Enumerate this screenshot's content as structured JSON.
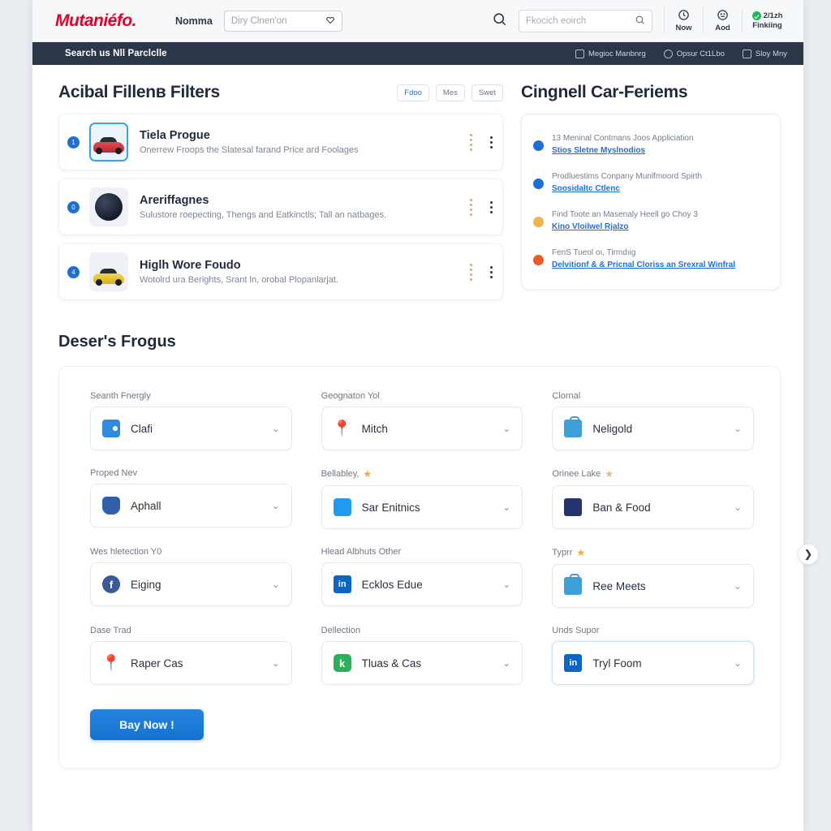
{
  "header": {
    "logo": "Mutaniéfo.",
    "brand_label": "Nomma",
    "location_placeholder": "Diry Clnen'on",
    "location_icon": "heart-icon",
    "search_placeholder": "Fkocich  eoirch",
    "actions": [
      {
        "label": "Now",
        "icon": "clock-icon"
      },
      {
        "label": "Aod",
        "icon": "smiley-icon"
      }
    ],
    "status": {
      "count": "2/1zh",
      "label": "Finkiing"
    }
  },
  "subnav": {
    "title": "Search us Nll Parclclle",
    "links": [
      {
        "label": "Megioc Manbnrg",
        "icon": "lock-icon"
      },
      {
        "label": "Opsur Ct1Lbo",
        "icon": "contact-icon"
      },
      {
        "label": "Sloy Mny",
        "icon": "camera-icon"
      }
    ]
  },
  "filters_section": {
    "title": "Acibal Fillenв Filters",
    "chips": [
      {
        "label": "Fdoo",
        "active": true
      },
      {
        "label": "Mes",
        "active": false
      },
      {
        "label": "Swet",
        "active": false
      }
    ],
    "items": [
      {
        "badge": "1",
        "title": "Tiela Progue",
        "subtitle": "Onerrew Froops the Slatesal farand Price ard Foolages",
        "thumb": "red-car-icon",
        "selected": true
      },
      {
        "badge": "0",
        "title": "Areriffagnes",
        "subtitle": "Sulustore roepecting, Thengs and Eatkinctls; Tall an natbages.",
        "thumb": "dark-orb-icon",
        "selected": false
      },
      {
        "badge": "4",
        "title": "Higlh Wore Foudo",
        "subtitle": "Wotolrd ura Berights, Srant ln, orobal Plopanlarjat.",
        "thumb": "yellow-car-icon",
        "selected": false
      }
    ]
  },
  "right_panel": {
    "title": "Cingnell Car-Feriems",
    "items": [
      {
        "dot": "#1d6fd4",
        "text": "13 Meninal Contmans Joos Appliciation",
        "link": "Stios Sletne Mуslnodios"
      },
      {
        "dot": "#1d6fd4",
        "text": "Prodluestims Conpany Munlfmoord Spirth",
        "link": "Soosidaltc Ctlenc"
      },
      {
        "dot": "#f0b44a",
        "text": "Find Toote an Masenaly Heell go Choу 3",
        "link": "Kino Vloilwel Rjalzo"
      },
      {
        "dot": "#ef5a22",
        "text": "FenS Tueol oı, Tirmdıig",
        "link": "Delvitionf & & Pricnal Cloriss an Srexral Winfral"
      }
    ]
  },
  "form_section": {
    "title": "Deser's Frogus",
    "fields": [
      {
        "label": "Seanth Fnergly",
        "value": "Clafi",
        "icon": "wallet-icon",
        "icon_class": "ic-wallet",
        "starred": false,
        "focus": false
      },
      {
        "label": "Geognaton Yol",
        "value": "Mitch",
        "icon": "pin-icon",
        "icon_class": "ic-pin",
        "starred": false,
        "focus": false
      },
      {
        "label": "Clornal",
        "value": "Neligold",
        "icon": "bag-icon",
        "icon_class": "ic-bag",
        "starred": false,
        "focus": false
      },
      {
        "label": "Proped Nev",
        "value": "Aphall",
        "icon": "owl-icon",
        "icon_class": "ic-owl",
        "starred": false,
        "focus": false
      },
      {
        "label": "Bellabley,",
        "value": "Sar Enitnics",
        "icon": "twitter-icon",
        "icon_class": "ic-tw",
        "starred": true,
        "focus": false
      },
      {
        "label": "Orinee Lake",
        "value": "Ban & Food",
        "icon": "news-icon",
        "icon_class": "ic-news",
        "starred": true,
        "star_grey": true,
        "focus": false
      },
      {
        "label": "Wes hletection Y0",
        "value": "Eiging",
        "icon": "facebook-icon",
        "icon_class": "ic-fb",
        "starred": false,
        "focus": false
      },
      {
        "label": "Hlead Albhuts Other",
        "value": "Ecklos Edue",
        "icon": "linkedin-icon",
        "icon_class": "ic-li",
        "starred": false,
        "focus": false
      },
      {
        "label": "Typrr",
        "value": "Ree Meets",
        "icon": "bag-icon",
        "icon_class": "ic-bag",
        "starred": true,
        "focus": false
      },
      {
        "label": "Dase Trad",
        "value": "Raper Cas",
        "icon": "pin-icon",
        "icon_class": "ic-pin",
        "starred": false,
        "focus": false
      },
      {
        "label": "Dellection",
        "value": "Tluas & Cas",
        "icon": "green-icon",
        "icon_class": "ic-gr",
        "starred": false,
        "focus": false
      },
      {
        "label": "Unds Supor",
        "value": "Tryl Foom",
        "icon": "linkedin-icon",
        "icon_class": "ic-li",
        "starred": false,
        "focus": true
      }
    ],
    "submit_label": "Bay Now !",
    "next_icon": "chevron-right-icon"
  }
}
